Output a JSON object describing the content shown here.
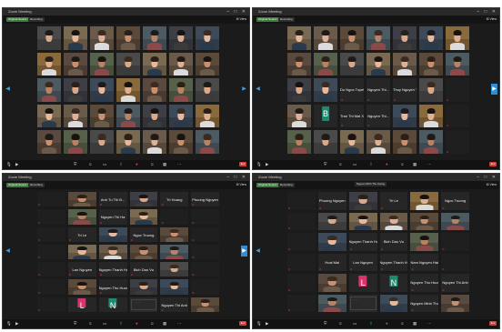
{
  "windows": [
    {
      "title": "Zoom Meeting",
      "pills": [
        "Original Sound: Off",
        "Recording"
      ],
      "view_label": "View",
      "toolbar": {
        "end": "End"
      },
      "cols": 7,
      "tiles": [
        {
          "type": "cam",
          "label": ""
        },
        {
          "type": "cam",
          "label": ""
        },
        {
          "type": "cam",
          "label": ""
        },
        {
          "type": "cam",
          "label": ""
        },
        {
          "type": "cam",
          "label": ""
        },
        {
          "type": "cam",
          "label": ""
        },
        {
          "type": "cam",
          "label": ""
        },
        {
          "type": "cam",
          "label": ""
        },
        {
          "type": "cam",
          "label": ""
        },
        {
          "type": "cam",
          "label": ""
        },
        {
          "type": "cam",
          "label": ""
        },
        {
          "type": "cam",
          "label": ""
        },
        {
          "type": "cam",
          "label": ""
        },
        {
          "type": "cam",
          "label": ""
        },
        {
          "type": "cam",
          "label": ""
        },
        {
          "type": "cam",
          "label": ""
        },
        {
          "type": "cam",
          "label": ""
        },
        {
          "type": "cam",
          "label": ""
        },
        {
          "type": "cam",
          "label": ""
        },
        {
          "type": "cam",
          "label": ""
        },
        {
          "type": "cam",
          "label": ""
        },
        {
          "type": "cam",
          "label": ""
        },
        {
          "type": "cam",
          "label": ""
        },
        {
          "type": "cam",
          "label": ""
        },
        {
          "type": "cam",
          "label": ""
        },
        {
          "type": "cam",
          "label": ""
        },
        {
          "type": "cam",
          "label": ""
        },
        {
          "type": "cam",
          "label": ""
        },
        {
          "type": "cam",
          "label": ""
        },
        {
          "type": "cam",
          "label": ""
        },
        {
          "type": "cam",
          "label": ""
        },
        {
          "type": "cam",
          "label": ""
        },
        {
          "type": "cam",
          "label": ""
        },
        {
          "type": "cam",
          "label": ""
        },
        {
          "type": "cam",
          "label": ""
        }
      ]
    },
    {
      "title": "Zoom Meeting",
      "pills": [
        "Original Sound: Off",
        "Recording"
      ],
      "view_label": "View",
      "toolbar": {
        "end": "End"
      },
      "cols": 7,
      "tiles": [
        {
          "type": "cam",
          "label": ""
        },
        {
          "type": "cam",
          "label": ""
        },
        {
          "type": "cam",
          "label": ""
        },
        {
          "type": "cam",
          "label": ""
        },
        {
          "type": "cam",
          "label": ""
        },
        {
          "type": "cam",
          "label": ""
        },
        {
          "type": "cam",
          "label": ""
        },
        {
          "type": "cam",
          "label": ""
        },
        {
          "type": "cam",
          "label": ""
        },
        {
          "type": "cam",
          "label": ""
        },
        {
          "type": "cam",
          "label": ""
        },
        {
          "type": "cam",
          "label": ""
        },
        {
          "type": "cam",
          "label": ""
        },
        {
          "type": "cam",
          "label": ""
        },
        {
          "type": "cam",
          "label": ""
        },
        {
          "type": "cam",
          "label": ""
        },
        {
          "type": "name",
          "label": "Do Ngoc Tuyet",
          "name": "Do Ngoc Tuyet"
        },
        {
          "type": "name",
          "label": "Nguyen Thi Hoa",
          "name": "Nguyen Thi..."
        },
        {
          "type": "name",
          "label": "Thuy Nguyen",
          "name": "Thuy Nguyen T..."
        },
        {
          "type": "cam",
          "label": ""
        },
        {
          "type": "empty",
          "label": ""
        },
        {
          "type": "cam",
          "label": ""
        },
        {
          "type": "letter",
          "letter": "B",
          "color": "#1f8a70",
          "label": "B"
        },
        {
          "type": "name",
          "label": "Tran Thi Mai",
          "name": "Tran Thi Mai X..."
        },
        {
          "type": "name",
          "label": "Nguyen Thi",
          "name": "Nguyen Thi..."
        },
        {
          "type": "cam",
          "label": ""
        },
        {
          "type": "cam",
          "label": ""
        },
        {
          "type": "empty",
          "label": ""
        },
        {
          "type": "cam",
          "label": ""
        },
        {
          "type": "cam",
          "label": ""
        },
        {
          "type": "cam",
          "label": ""
        },
        {
          "type": "cam",
          "label": ""
        },
        {
          "type": "cam",
          "label": ""
        },
        {
          "type": "cam",
          "label": ""
        },
        {
          "type": "empty",
          "label": ""
        }
      ]
    },
    {
      "title": "Zoom Meeting",
      "pills": [
        "Original Sound: Off",
        "Recording"
      ],
      "view_label": "View",
      "toolbar": {
        "end": "End"
      },
      "cols": 6,
      "tiles": [
        {
          "type": "empty",
          "label": ""
        },
        {
          "type": "cam",
          "label": ""
        },
        {
          "type": "name",
          "label": "",
          "name": "Anh Tu Thi B..."
        },
        {
          "type": "cam",
          "label": ""
        },
        {
          "type": "name",
          "label": "",
          "name": "Tri Hoang"
        },
        {
          "type": "name",
          "label": "",
          "name": "Phuong Nguyen"
        },
        {
          "type": "empty",
          "label": ""
        },
        {
          "type": "cam",
          "label": ""
        },
        {
          "type": "name",
          "label": "",
          "name": "Nguyen Thi Ha"
        },
        {
          "type": "cam",
          "label": ""
        },
        {
          "type": "empty",
          "label": ""
        },
        {
          "type": "empty",
          "label": ""
        },
        {
          "type": "empty",
          "label": ""
        },
        {
          "type": "name",
          "label": "",
          "name": "Tri Le"
        },
        {
          "type": "cam",
          "label": ""
        },
        {
          "type": "name",
          "label": "",
          "name": "Ngoc Truong"
        },
        {
          "type": "cam",
          "label": ""
        },
        {
          "type": "empty",
          "label": ""
        },
        {
          "type": "empty",
          "label": ""
        },
        {
          "type": "cam",
          "label": ""
        },
        {
          "type": "cam",
          "label": ""
        },
        {
          "type": "cam",
          "label": ""
        },
        {
          "type": "cam",
          "label": ""
        },
        {
          "type": "empty",
          "label": ""
        },
        {
          "type": "empty",
          "label": ""
        },
        {
          "type": "name",
          "label": "",
          "name": "Lan Nguyen"
        },
        {
          "type": "name",
          "label": "",
          "name": "Nguyen Thanh Ha"
        },
        {
          "type": "name",
          "label": "",
          "name": "Bich Dao Vu"
        },
        {
          "type": "cam",
          "label": ""
        },
        {
          "type": "empty",
          "label": ""
        },
        {
          "type": "empty",
          "label": ""
        },
        {
          "type": "cam",
          "label": ""
        },
        {
          "type": "name",
          "label": "",
          "name": "Nguyen Thu Huong"
        },
        {
          "type": "cam",
          "label": ""
        },
        {
          "type": "cam",
          "label": ""
        },
        {
          "type": "empty",
          "label": ""
        },
        {
          "type": "empty",
          "label": ""
        },
        {
          "type": "letter",
          "letter": "L",
          "color": "#d9346e",
          "label": ""
        },
        {
          "type": "letter",
          "letter": "N",
          "color": "#1f8a70",
          "label": ""
        },
        {
          "type": "chat",
          "label": ""
        },
        {
          "type": "name",
          "label": "",
          "name": "Nguyen Thi Anh"
        },
        {
          "type": "cam",
          "label": ""
        }
      ]
    },
    {
      "title": "Zoom Meeting",
      "pills": [
        "Original Sound: Off",
        "Recording"
      ],
      "view_label": "View",
      "tooltip": "Nguyen Minh Thu Huong",
      "toolbar": {
        "end": "End"
      },
      "cols": 6,
      "tiles": [
        {
          "type": "empty",
          "label": ""
        },
        {
          "type": "name",
          "label": "",
          "name": "Phuong Nguyen"
        },
        {
          "type": "cam",
          "label": ""
        },
        {
          "type": "name",
          "label": "",
          "name": "Tri Le"
        },
        {
          "type": "cam",
          "label": ""
        },
        {
          "type": "name",
          "label": "",
          "name": "Ngoc Truong"
        },
        {
          "type": "empty",
          "label": ""
        },
        {
          "type": "cam",
          "label": ""
        },
        {
          "type": "cam",
          "label": ""
        },
        {
          "type": "cam",
          "label": ""
        },
        {
          "type": "cam",
          "label": ""
        },
        {
          "type": "cam",
          "label": ""
        },
        {
          "type": "empty",
          "label": ""
        },
        {
          "type": "cam",
          "label": ""
        },
        {
          "type": "name",
          "label": "",
          "name": "Nguyen Thanh Ha"
        },
        {
          "type": "name",
          "label": "",
          "name": "Bich Dao Vu"
        },
        {
          "type": "cam",
          "label": ""
        },
        {
          "type": "empty",
          "label": ""
        },
        {
          "type": "empty",
          "label": ""
        },
        {
          "type": "name",
          "label": "",
          "name": "Hoai Mai"
        },
        {
          "type": "name",
          "label": "",
          "name": "Lan Nguyen"
        },
        {
          "type": "name",
          "label": "",
          "name": "Nguyen Thanh Ha"
        },
        {
          "type": "name",
          "label": "",
          "name": "Nam Nguyen Hai"
        },
        {
          "type": "empty",
          "label": ""
        },
        {
          "type": "empty",
          "label": ""
        },
        {
          "type": "cam",
          "label": ""
        },
        {
          "type": "letter",
          "letter": "L",
          "color": "#d9346e",
          "label": ""
        },
        {
          "type": "letter",
          "letter": "N",
          "color": "#1f8a70",
          "label": ""
        },
        {
          "type": "name",
          "label": "",
          "name": "Nguyen Thu Huong"
        },
        {
          "type": "name",
          "label": "",
          "name": "Nguyen Thi Anh"
        },
        {
          "type": "empty",
          "label": ""
        },
        {
          "type": "cam",
          "label": ""
        },
        {
          "type": "chat",
          "label": ""
        },
        {
          "type": "cam",
          "label": ""
        },
        {
          "type": "name",
          "label": "",
          "name": "Nguyen Minh Thu"
        },
        {
          "type": "cam",
          "label": ""
        }
      ]
    }
  ],
  "colors": {
    "zoom_bg": "#1b1b1b",
    "end_red": "#d43b3b",
    "accent_blue": "#2f8fd6",
    "green": "#3fbf5a"
  },
  "icons": [
    "mute-icon",
    "video-icon",
    "security-icon",
    "participants-icon",
    "chat-icon",
    "share-icon",
    "record-icon",
    "reactions-icon",
    "next-page-icon"
  ]
}
